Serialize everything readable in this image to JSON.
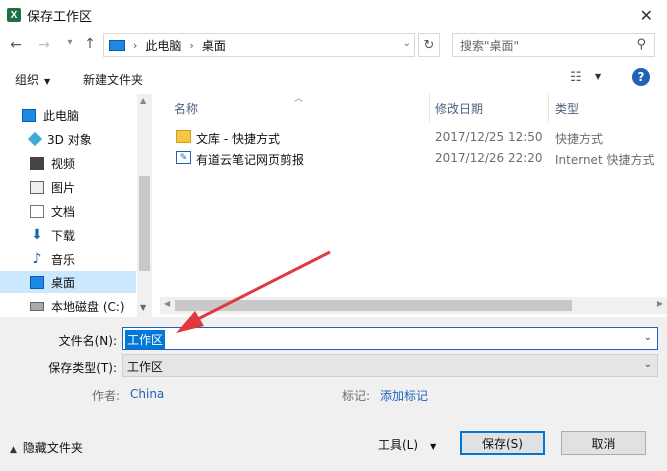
{
  "window": {
    "title": "保存工作区",
    "app_icon_glyph": "X"
  },
  "address": {
    "breadcrumbs": [
      "此电脑",
      "桌面"
    ],
    "search_placeholder": "搜索\"桌面\""
  },
  "toolbar": {
    "organize": "组织",
    "new_folder": "新建文件夹"
  },
  "nav": {
    "items": [
      {
        "label": "此电脑",
        "icon": "pc-icon"
      },
      {
        "label": "3D 对象",
        "icon": "3d-objects-icon"
      },
      {
        "label": "视频",
        "icon": "video-icon"
      },
      {
        "label": "图片",
        "icon": "pictures-icon"
      },
      {
        "label": "文档",
        "icon": "documents-icon"
      },
      {
        "label": "下载",
        "icon": "download-icon"
      },
      {
        "label": "音乐",
        "icon": "music-icon"
      },
      {
        "label": "桌面",
        "icon": "desktop-icon",
        "selected": true
      },
      {
        "label": "本地磁盘 (C:)",
        "icon": "disk-icon"
      }
    ]
  },
  "files": {
    "columns": {
      "name": "名称",
      "date": "修改日期",
      "type": "类型"
    },
    "rows": [
      {
        "name": "文库 - 快捷方式",
        "date": "2017/12/25 12:50",
        "type": "快捷方式",
        "icon": "folder-shortcut-icon"
      },
      {
        "name": "有道云笔记网页剪报",
        "date": "2017/12/26 22:20",
        "type": "Internet 快捷方式",
        "icon": "youdao-icon"
      }
    ]
  },
  "form": {
    "filename_label": "文件名(N):",
    "filename_value": "工作区",
    "filetype_label": "保存类型(T):",
    "filetype_value": "工作区",
    "author_label": "作者:",
    "author_value": "China",
    "tags_label": "标记:",
    "tags_value": "添加标记"
  },
  "footer": {
    "hide_folders": "隐藏文件夹",
    "tools": "工具(L)",
    "save": "保存(S)",
    "cancel": "取消"
  },
  "colors": {
    "accent": "#0078d7",
    "annotation_arrow": "#e0393e",
    "link": "#1e63b8"
  }
}
